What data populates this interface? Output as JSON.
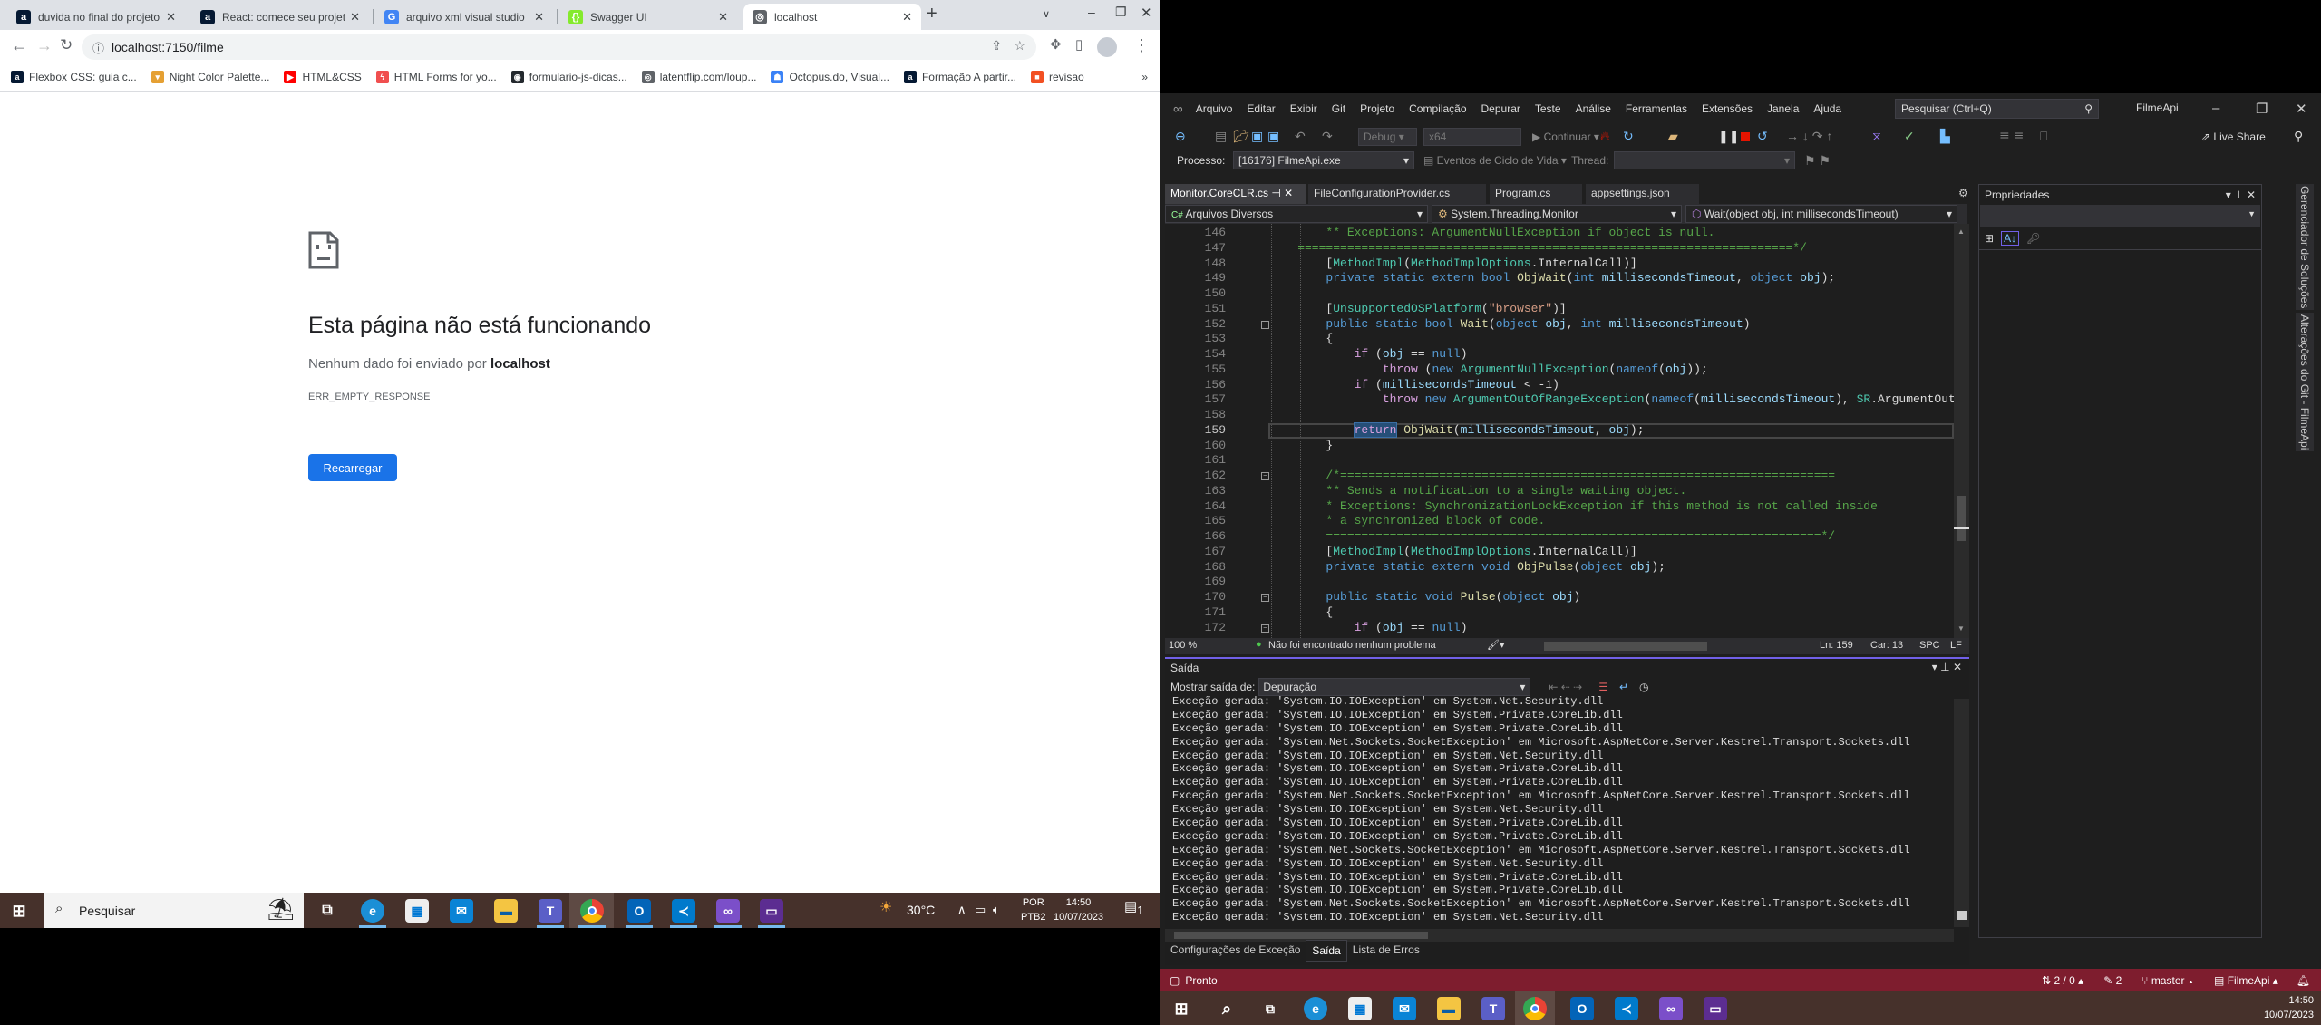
{
  "chrome": {
    "tabs": [
      {
        "title": "duvida no final do projeto",
        "icon": "alura-icon",
        "color": "#051933",
        "glyph": "a"
      },
      {
        "title": "React: comece seu projeto",
        "icon": "alura-icon",
        "color": "#051933",
        "glyph": "a"
      },
      {
        "title": "arquivo xml visual studio",
        "icon": "google-icon",
        "color": "#4285f4",
        "glyph": "G"
      },
      {
        "title": "Swagger UI",
        "icon": "swagger-icon",
        "color": "#85ea2d",
        "glyph": "{}"
      },
      {
        "title": "localhost",
        "icon": "globe-icon",
        "color": "#5f6368",
        "glyph": "◎"
      }
    ],
    "active_tab": 4,
    "new_tab": "+",
    "url": "localhost:7150/filme",
    "bookmarks": [
      {
        "label": "Flexbox CSS: guia c...",
        "icon": "alura-icon",
        "color": "#051933",
        "glyph": "a"
      },
      {
        "label": "Night Color Palette...",
        "icon": "potion-icon",
        "color": "#e5a033",
        "glyph": "▾"
      },
      {
        "label": "HTML&CSS",
        "icon": "youtube-icon",
        "color": "#ff0000",
        "glyph": "▶"
      },
      {
        "label": "HTML Forms for yo...",
        "icon": "lightning-icon",
        "color": "#f04f4f",
        "glyph": "ϟ"
      },
      {
        "label": "formulario-js-dicas...",
        "icon": "github-icon",
        "color": "#24292e",
        "glyph": "◉"
      },
      {
        "label": "latentflip.com/loup...",
        "icon": "globe-icon",
        "color": "#5f6368",
        "glyph": "◎"
      },
      {
        "label": "Octopus.do, Visual...",
        "icon": "octopus-icon",
        "color": "#3b82f6",
        "glyph": "☗"
      },
      {
        "label": "Formação A partir...",
        "icon": "alura-icon",
        "color": "#051933",
        "glyph": "a"
      },
      {
        "label": "revisao",
        "icon": "microsoft-icon",
        "color": "#f25022",
        "glyph": "■"
      }
    ],
    "error": {
      "title": "Esta página não está funcionando",
      "sub_prefix": "Nenhum dado foi enviado por ",
      "sub_host": "localhost",
      "code": "ERR_EMPTY_RESPONSE",
      "reload": "Recarregar"
    }
  },
  "taskbar_left": {
    "search": "Pesquisar",
    "weather": "30°C",
    "lang1": "POR",
    "lang2": "PTB2",
    "time": "14:50",
    "date": "10/07/2023",
    "notifications": "1"
  },
  "vs": {
    "menu": [
      "Arquivo",
      "Editar",
      "Exibir",
      "Git",
      "Projeto",
      "Compilação",
      "Depurar",
      "Teste",
      "Análise",
      "Ferramentas",
      "Extensões",
      "Janela",
      "Ajuda"
    ],
    "search_placeholder": "Pesquisar (Ctrl+Q)",
    "solution_name": "FilmeApi",
    "toolbar": {
      "config": "Debug",
      "platform": "x64",
      "continue": "Continuar",
      "live_share": "Live Share"
    },
    "process_label": "Processo:",
    "process": "[16176] FilmeApi.exe",
    "lifecycle": "Eventos de Ciclo de Vida",
    "thread_label": "Thread:",
    "tabs": [
      "Monitor.CoreCLR.cs",
      "FileConfigurationProvider.cs",
      "Program.cs",
      "appsettings.json"
    ],
    "nav": {
      "project": "Arquivos Diversos",
      "type": "System.Threading.Monitor",
      "member": "Wait(object obj, int millisecondsTimeout)"
    },
    "current_line": 159,
    "code": [
      {
        "n": 146,
        "tokens": [
          [
            "        ** Exceptions: ArgumentNullException if object is null.",
            "c"
          ]
        ]
      },
      {
        "n": 147,
        "tokens": [
          [
            "    ======================================================================*/",
            "c"
          ]
        ]
      },
      {
        "n": 148,
        "tokens": [
          [
            "        [",
            ""
          ],
          [
            "MethodImpl",
            "t"
          ],
          [
            "(",
            ""
          ],
          [
            "MethodImplOptions",
            "t"
          ],
          [
            ".InternalCall)]",
            ""
          ]
        ]
      },
      {
        "n": 149,
        "tokens": [
          [
            "        ",
            ""
          ],
          [
            "private static extern bool",
            "k"
          ],
          [
            " ",
            ""
          ],
          [
            "ObjWait",
            "m"
          ],
          [
            "(",
            ""
          ],
          [
            "int",
            "k"
          ],
          [
            " ",
            ""
          ],
          [
            "millisecondsTimeout",
            "p"
          ],
          [
            ", ",
            ""
          ],
          [
            "object",
            "k"
          ],
          [
            " ",
            ""
          ],
          [
            "obj",
            "p"
          ],
          [
            ");",
            ""
          ]
        ]
      },
      {
        "n": 150,
        "tokens": []
      },
      {
        "n": 151,
        "tokens": [
          [
            "        [",
            ""
          ],
          [
            "UnsupportedOSPlatform",
            "t"
          ],
          [
            "(",
            ""
          ],
          [
            "\"browser\"",
            "s"
          ],
          [
            ")]",
            ""
          ]
        ]
      },
      {
        "n": 152,
        "tokens": [
          [
            "        ",
            ""
          ],
          [
            "public static bool",
            "k"
          ],
          [
            " ",
            ""
          ],
          [
            "Wait",
            "m"
          ],
          [
            "(",
            ""
          ],
          [
            "object",
            "k"
          ],
          [
            " ",
            ""
          ],
          [
            "obj",
            "p"
          ],
          [
            ", ",
            ""
          ],
          [
            "int",
            "k"
          ],
          [
            " ",
            ""
          ],
          [
            "millisecondsTimeout",
            "p"
          ],
          [
            ")",
            ""
          ]
        ]
      },
      {
        "n": 153,
        "tokens": [
          [
            "        {",
            ""
          ]
        ]
      },
      {
        "n": 154,
        "tokens": [
          [
            "            ",
            ""
          ],
          [
            "if",
            "f"
          ],
          [
            " (",
            ""
          ],
          [
            "obj",
            "p"
          ],
          [
            " == ",
            ""
          ],
          [
            "null",
            "k"
          ],
          [
            ")",
            ""
          ]
        ]
      },
      {
        "n": 155,
        "tokens": [
          [
            "                ",
            ""
          ],
          [
            "throw",
            "f"
          ],
          [
            " (",
            ""
          ],
          [
            "new",
            "k"
          ],
          [
            " ",
            ""
          ],
          [
            "ArgumentNullException",
            "t"
          ],
          [
            "(",
            ""
          ],
          [
            "nameof",
            "k"
          ],
          [
            "(",
            ""
          ],
          [
            "obj",
            "p"
          ],
          [
            "));",
            ""
          ]
        ]
      },
      {
        "n": 156,
        "tokens": [
          [
            "            ",
            ""
          ],
          [
            "if",
            "f"
          ],
          [
            " (",
            ""
          ],
          [
            "millisecondsTimeout",
            "p"
          ],
          [
            " < -1)",
            ""
          ]
        ]
      },
      {
        "n": 157,
        "tokens": [
          [
            "                ",
            ""
          ],
          [
            "throw",
            "f"
          ],
          [
            " ",
            ""
          ],
          [
            "new",
            "k"
          ],
          [
            " ",
            ""
          ],
          [
            "ArgumentOutOfRangeException",
            "t"
          ],
          [
            "(",
            ""
          ],
          [
            "nameof",
            "k"
          ],
          [
            "(",
            ""
          ],
          [
            "millisecondsTimeout",
            "p"
          ],
          [
            "), ",
            ""
          ],
          [
            "SR",
            "t"
          ],
          [
            ".ArgumentOutOf",
            ""
          ]
        ]
      },
      {
        "n": 158,
        "tokens": []
      },
      {
        "n": 159,
        "tokens": [
          [
            "            ",
            ""
          ],
          [
            "return",
            "f sel"
          ],
          [
            " ",
            ""
          ],
          [
            "ObjWait",
            "m"
          ],
          [
            "(",
            ""
          ],
          [
            "millisecondsTimeout",
            "p"
          ],
          [
            ", ",
            ""
          ],
          [
            "obj",
            "p"
          ],
          [
            ");",
            ""
          ]
        ]
      },
      {
        "n": 160,
        "tokens": [
          [
            "        }",
            ""
          ]
        ]
      },
      {
        "n": 161,
        "tokens": []
      },
      {
        "n": 162,
        "tokens": [
          [
            "        /*======================================================================",
            "c"
          ]
        ]
      },
      {
        "n": 163,
        "tokens": [
          [
            "        ** Sends a notification to a single waiting object.",
            "c"
          ]
        ]
      },
      {
        "n": 164,
        "tokens": [
          [
            "        * Exceptions: SynchronizationLockException if this method is not called inside",
            "c"
          ]
        ]
      },
      {
        "n": 165,
        "tokens": [
          [
            "        * a synchronized block of code.",
            "c"
          ]
        ]
      },
      {
        "n": 166,
        "tokens": [
          [
            "        ======================================================================*/",
            "c"
          ]
        ]
      },
      {
        "n": 167,
        "tokens": [
          [
            "        [",
            ""
          ],
          [
            "MethodImpl",
            "t"
          ],
          [
            "(",
            ""
          ],
          [
            "MethodImplOptions",
            "t"
          ],
          [
            ".InternalCall)]",
            ""
          ]
        ]
      },
      {
        "n": 168,
        "tokens": [
          [
            "        ",
            ""
          ],
          [
            "private static extern void",
            "k"
          ],
          [
            " ",
            ""
          ],
          [
            "ObjPulse",
            "m"
          ],
          [
            "(",
            ""
          ],
          [
            "object",
            "k"
          ],
          [
            " ",
            ""
          ],
          [
            "obj",
            "p"
          ],
          [
            ");",
            ""
          ]
        ]
      },
      {
        "n": 169,
        "tokens": []
      },
      {
        "n": 170,
        "tokens": [
          [
            "        ",
            ""
          ],
          [
            "public static void",
            "k"
          ],
          [
            " ",
            ""
          ],
          [
            "Pulse",
            "m"
          ],
          [
            "(",
            ""
          ],
          [
            "object",
            "k"
          ],
          [
            " ",
            ""
          ],
          [
            "obj",
            "p"
          ],
          [
            ")",
            ""
          ]
        ]
      },
      {
        "n": 171,
        "tokens": [
          [
            "        {",
            ""
          ]
        ]
      },
      {
        "n": 172,
        "tokens": [
          [
            "            ",
            ""
          ],
          [
            "if",
            "f"
          ],
          [
            " (",
            ""
          ],
          [
            "obj",
            "p"
          ],
          [
            " == ",
            ""
          ],
          [
            "null",
            "k"
          ],
          [
            ")",
            ""
          ]
        ]
      }
    ],
    "folds": [
      152,
      162,
      170,
      172
    ],
    "editor_status": {
      "zoom": "100 %",
      "issues": "Não foi encontrado nenhum problema",
      "line": "Ln: 159",
      "col": "Car: 13",
      "spc": "SPC",
      "eol": "LF"
    },
    "output": {
      "title": "Saída",
      "show_label": "Mostrar saída de:",
      "source": "Depuração",
      "lines": [
        "Exceção gerada: 'System.IO.IOException' em System.Net.Security.dll",
        "Exceção gerada: 'System.IO.IOException' em System.Private.CoreLib.dll",
        "Exceção gerada: 'System.IO.IOException' em System.Private.CoreLib.dll",
        "Exceção gerada: 'System.Net.Sockets.SocketException' em Microsoft.AspNetCore.Server.Kestrel.Transport.Sockets.dll",
        "Exceção gerada: 'System.IO.IOException' em System.Net.Security.dll",
        "Exceção gerada: 'System.IO.IOException' em System.Private.CoreLib.dll",
        "Exceção gerada: 'System.IO.IOException' em System.Private.CoreLib.dll",
        "Exceção gerada: 'System.Net.Sockets.SocketException' em Microsoft.AspNetCore.Server.Kestrel.Transport.Sockets.dll",
        "Exceção gerada: 'System.IO.IOException' em System.Net.Security.dll",
        "Exceção gerada: 'System.IO.IOException' em System.Private.CoreLib.dll",
        "Exceção gerada: 'System.IO.IOException' em System.Private.CoreLib.dll",
        "Exceção gerada: 'System.Net.Sockets.SocketException' em Microsoft.AspNetCore.Server.Kestrel.Transport.Sockets.dll",
        "Exceção gerada: 'System.IO.IOException' em System.Net.Security.dll",
        "Exceção gerada: 'System.IO.IOException' em System.Private.CoreLib.dll",
        "Exceção gerada: 'System.IO.IOException' em System.Private.CoreLib.dll",
        "Exceção gerada: 'System.Net.Sockets.SocketException' em Microsoft.AspNetCore.Server.Kestrel.Transport.Sockets.dll",
        "Exceção gerada: 'System.IO.IOException' em System.Net.Security.dll"
      ]
    },
    "bottom_tabs": [
      "Configurações de Exceção",
      "Saída",
      "Lista de Erros"
    ],
    "active_bottom_tab": 1,
    "properties_title": "Propriedades",
    "side_tabs": [
      "Gerenciador de Soluções",
      "Alterações do Git - FilmeApi"
    ],
    "status": {
      "ready": "Pronto",
      "sync": "2 / 0",
      "changes": "2",
      "branch": "master",
      "repo": "FilmeApi"
    },
    "status_color": "#7e1d2e"
  },
  "taskbar_right": {
    "time": "14:50",
    "date": "10/07/2023"
  }
}
